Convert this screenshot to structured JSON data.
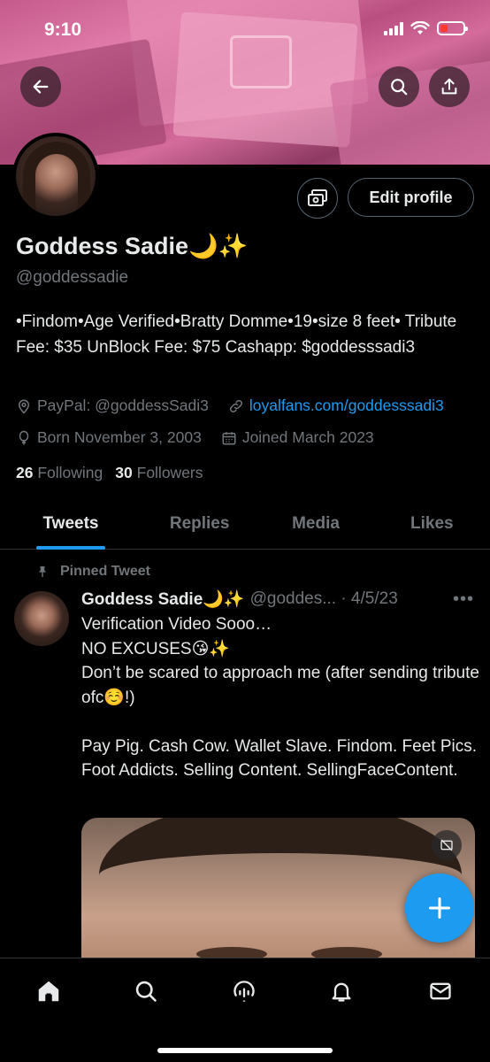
{
  "status_bar": {
    "time": "9:10"
  },
  "profile": {
    "name": "Goddess Sadie🌙✨",
    "handle": "@goddessadie",
    "bio": "•Findom•Age Verified•Bratty Domme•19•size 8 feet• Tribute Fee: $35 UnBlock Fee: $75 Cashapp: $goddesssadi3",
    "location": "PayPal: @goddessSadi3",
    "website": "loyalfans.com/goddesssadi3",
    "birthday": "Born November 3, 2003",
    "joined": "Joined March 2023",
    "following_count": "26",
    "following_label": "Following",
    "followers_count": "30",
    "followers_label": "Followers",
    "edit_label": "Edit profile"
  },
  "tabs": [
    "Tweets",
    "Replies",
    "Media",
    "Likes"
  ],
  "pinned_tweet": {
    "pinned_label": "Pinned Tweet",
    "author_name": "Goddess Sadie🌙✨",
    "author_handle_date": "@goddes... · 4/5/23",
    "text": "Verification Video Sooo…\nNO EXCUSES😘✨\nDon’t be scared to approach me (after sending tribute ofc☺️!)\n\nPay Pig. Cash Cow. Wallet Slave. Findom. Feet Pics. Foot Addicts. Selling Content. SellingFaceContent."
  },
  "icons": {
    "back": "arrow-left-icon",
    "search": "search-icon",
    "share": "share-icon",
    "money": "money-icon",
    "location": "location-pin-icon",
    "link": "link-icon",
    "balloon": "birthday-balloon-icon",
    "calendar": "calendar-icon",
    "pin": "pin-icon",
    "compose": "plus-icon",
    "home": "home-icon",
    "explore": "search-icon",
    "spaces": "spaces-icon",
    "notifications": "bell-icon",
    "messages": "mail-icon"
  },
  "colors": {
    "accent": "#1d9bf0",
    "background": "#000000",
    "text": "#e7e9ea",
    "muted": "#71767b"
  }
}
